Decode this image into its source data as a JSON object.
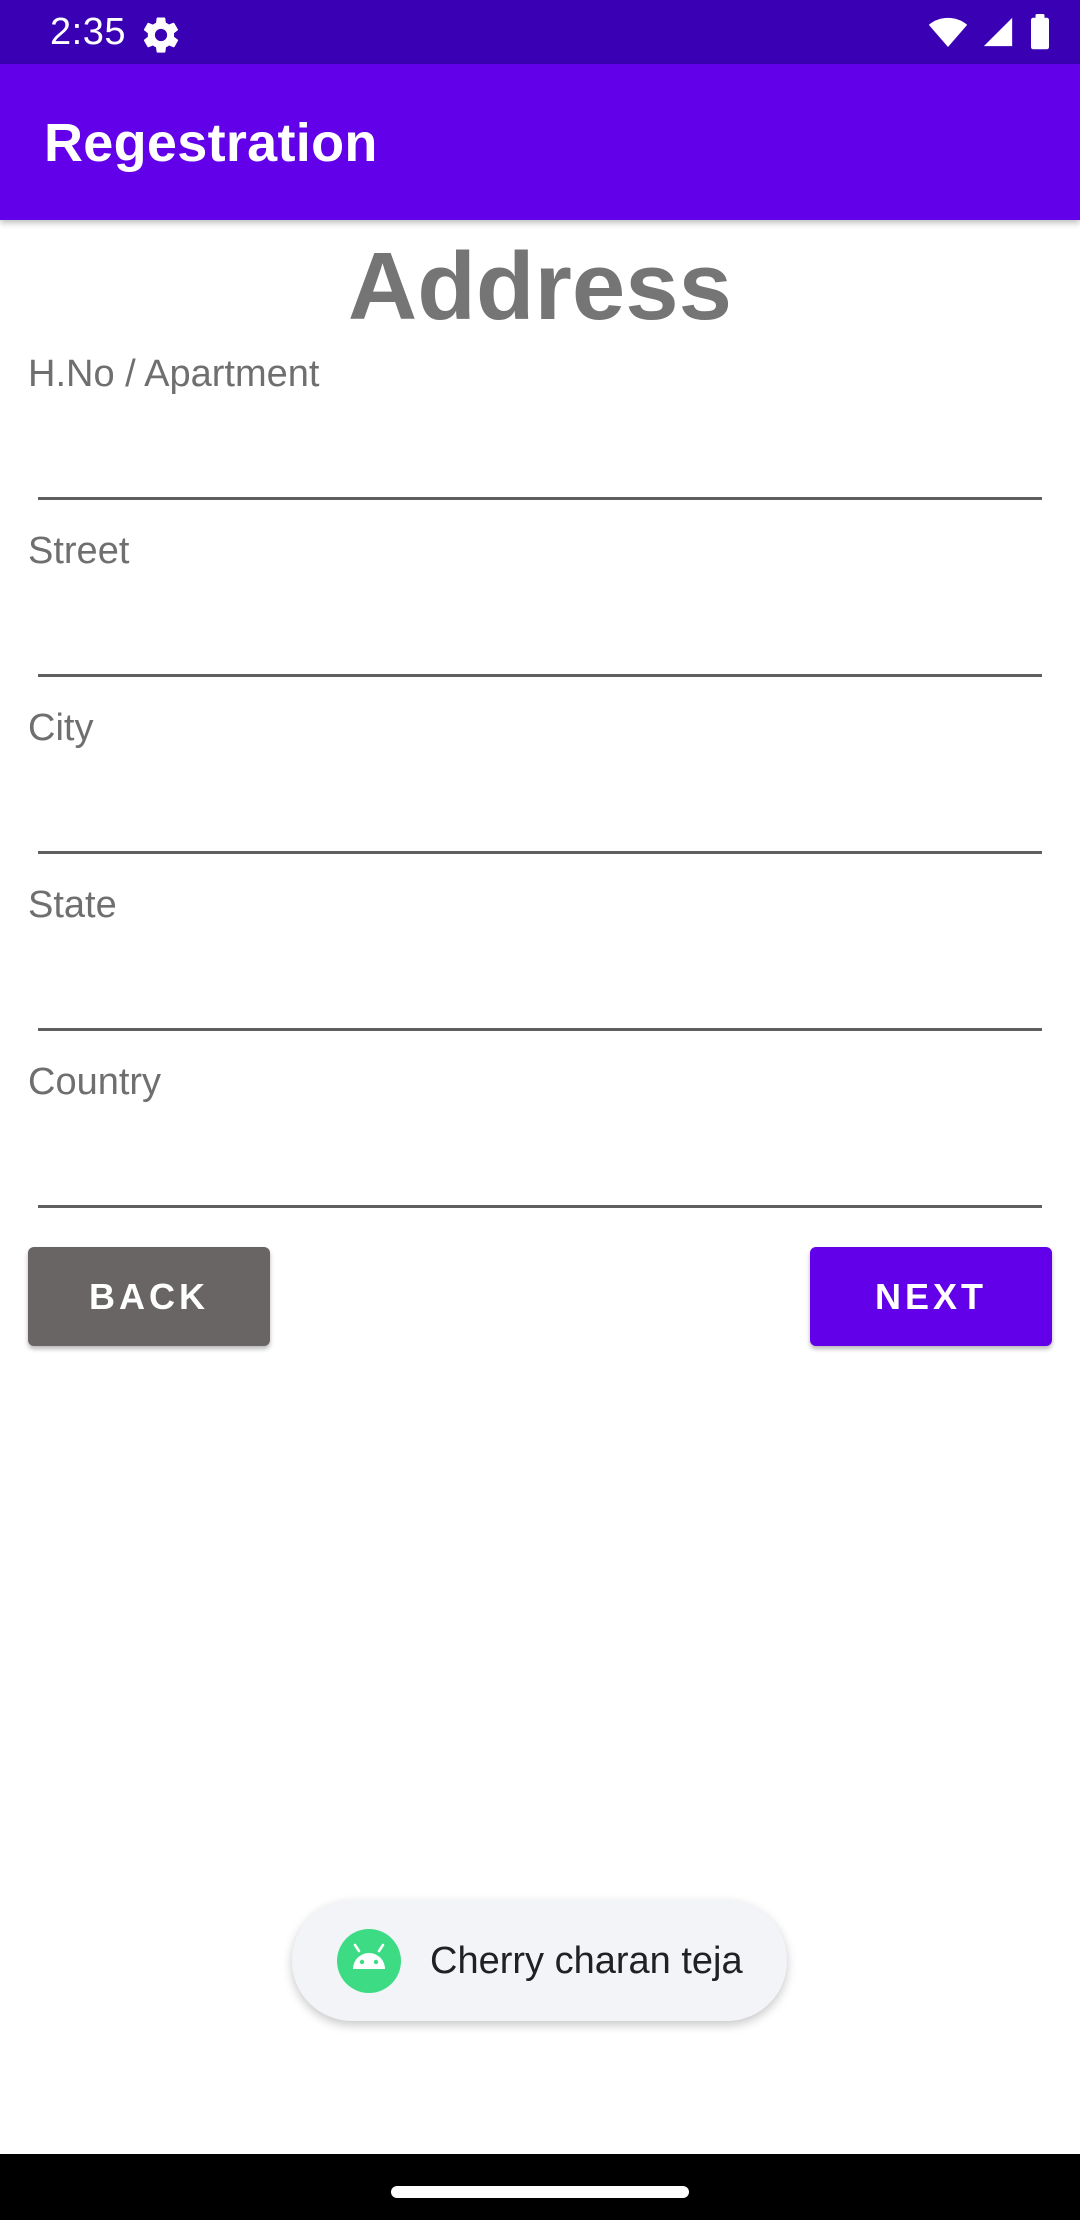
{
  "status_bar": {
    "time": "2:35",
    "icons": [
      "gear-icon",
      "wifi-icon",
      "signal-icon",
      "battery-icon"
    ]
  },
  "app_bar": {
    "title": "Regestration"
  },
  "form": {
    "heading": "Address",
    "fields": [
      {
        "label": "H.No / Apartment",
        "value": ""
      },
      {
        "label": "Street",
        "value": ""
      },
      {
        "label": "City",
        "value": ""
      },
      {
        "label": "State",
        "value": ""
      },
      {
        "label": "Country",
        "value": ""
      }
    ]
  },
  "buttons": {
    "back": "BACK",
    "next": "NEXT"
  },
  "toast": {
    "icon": "android-icon",
    "text": "Cherry charan teja"
  },
  "colors": {
    "status_bar": "#3a00b4",
    "primary": "#6200ea",
    "back_button": "#686564",
    "heading_text": "#757575",
    "label_text": "#6f6f6f"
  }
}
